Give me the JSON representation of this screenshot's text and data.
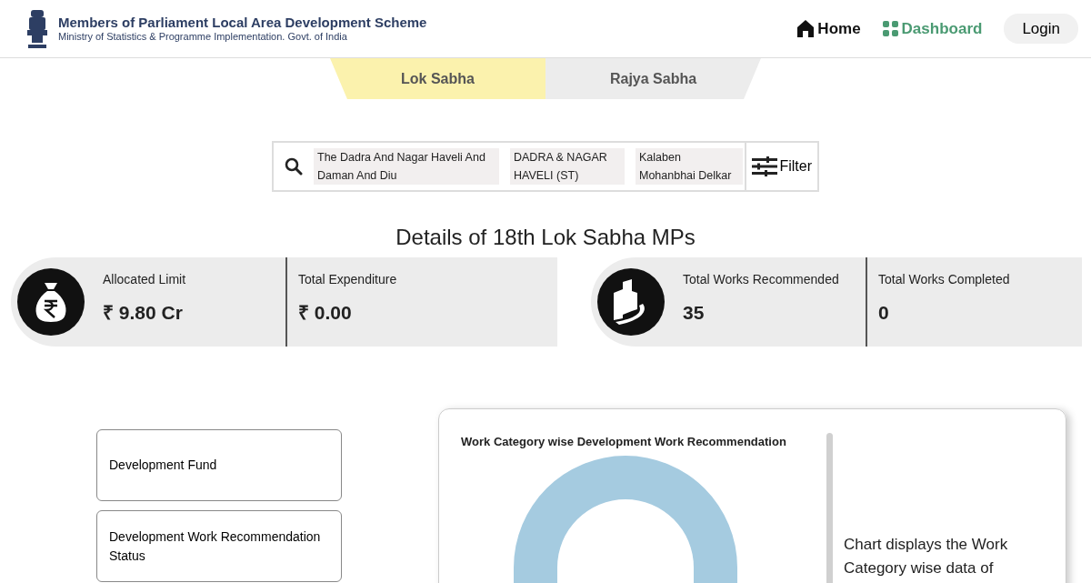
{
  "header": {
    "title": "Members of Parliament Local Area Development Scheme",
    "subtitle": "Ministry of Statistics & Programme Implementation. Govt. of India"
  },
  "nav": [
    {
      "label": "Home",
      "selected": false
    },
    {
      "label": "Dashboard",
      "selected": true
    }
  ],
  "login": "Login",
  "tabs": [
    {
      "label": "Lok Sabha",
      "selected": true
    },
    {
      "label": "Rajya Sabha",
      "selected": false
    }
  ],
  "search": {
    "chips": [
      "The Dadra And Nagar Haveli And Daman And Diu",
      "DADRA & NAGAR HAVELI (ST)",
      "Kalaben Mohanbhai Delkar"
    ],
    "filter": "Filter"
  },
  "heading": "Details of 18th Lok Sabha MPs",
  "stat_groups": [
    {
      "stats": [
        {
          "label": "Allocated Limit",
          "value": "₹ 9.80 Cr"
        },
        {
          "label": "Total Expenditure",
          "value": "₹ 0.00"
        }
      ]
    },
    {
      "stats": [
        {
          "label": "Total Works Recommended",
          "value": "35"
        },
        {
          "label": "Total Works Completed",
          "value": "0"
        }
      ]
    }
  ],
  "side_menu": [
    "Development Fund",
    "Development Work Recommendation Status"
  ],
  "chart_card": {
    "title": "Work Category wise Development Work Recommendation",
    "description": "Chart displays the Work Category wise data of"
  }
}
